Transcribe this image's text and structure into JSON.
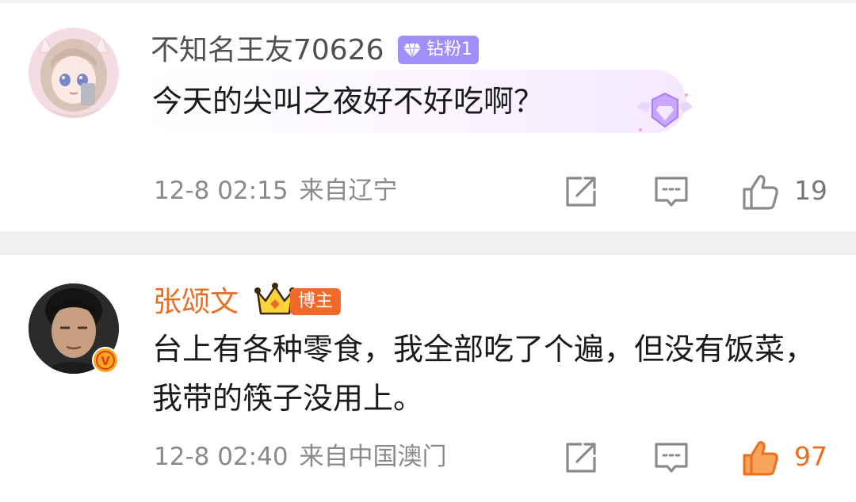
{
  "comments": [
    {
      "username": "不知名王友70626",
      "badge": "钻粉1",
      "text": "今天的尖叫之夜好不好吃啊？",
      "time": "12-8 02:15",
      "location": "来自辽宁",
      "likes": "19",
      "liked": false,
      "avatar_icon": "anime-girl-avatar",
      "colors": {
        "name": "#505050",
        "badge_bg": "#9f8ffb"
      }
    },
    {
      "username": "张颂文",
      "badge": "博主",
      "text": "台上有各种零食，我全部吃了个遍，但没有饭菜，我带的筷子没用上。",
      "time": "12-8 02:40",
      "location": "来自中国澳门",
      "likes": "97",
      "liked": true,
      "avatar_icon": "man-avatar",
      "verified_mark": "V",
      "colors": {
        "name": "#ee6d1f",
        "badge_bg": "#f3692a",
        "like_active": "#ee6d1f"
      }
    }
  ]
}
